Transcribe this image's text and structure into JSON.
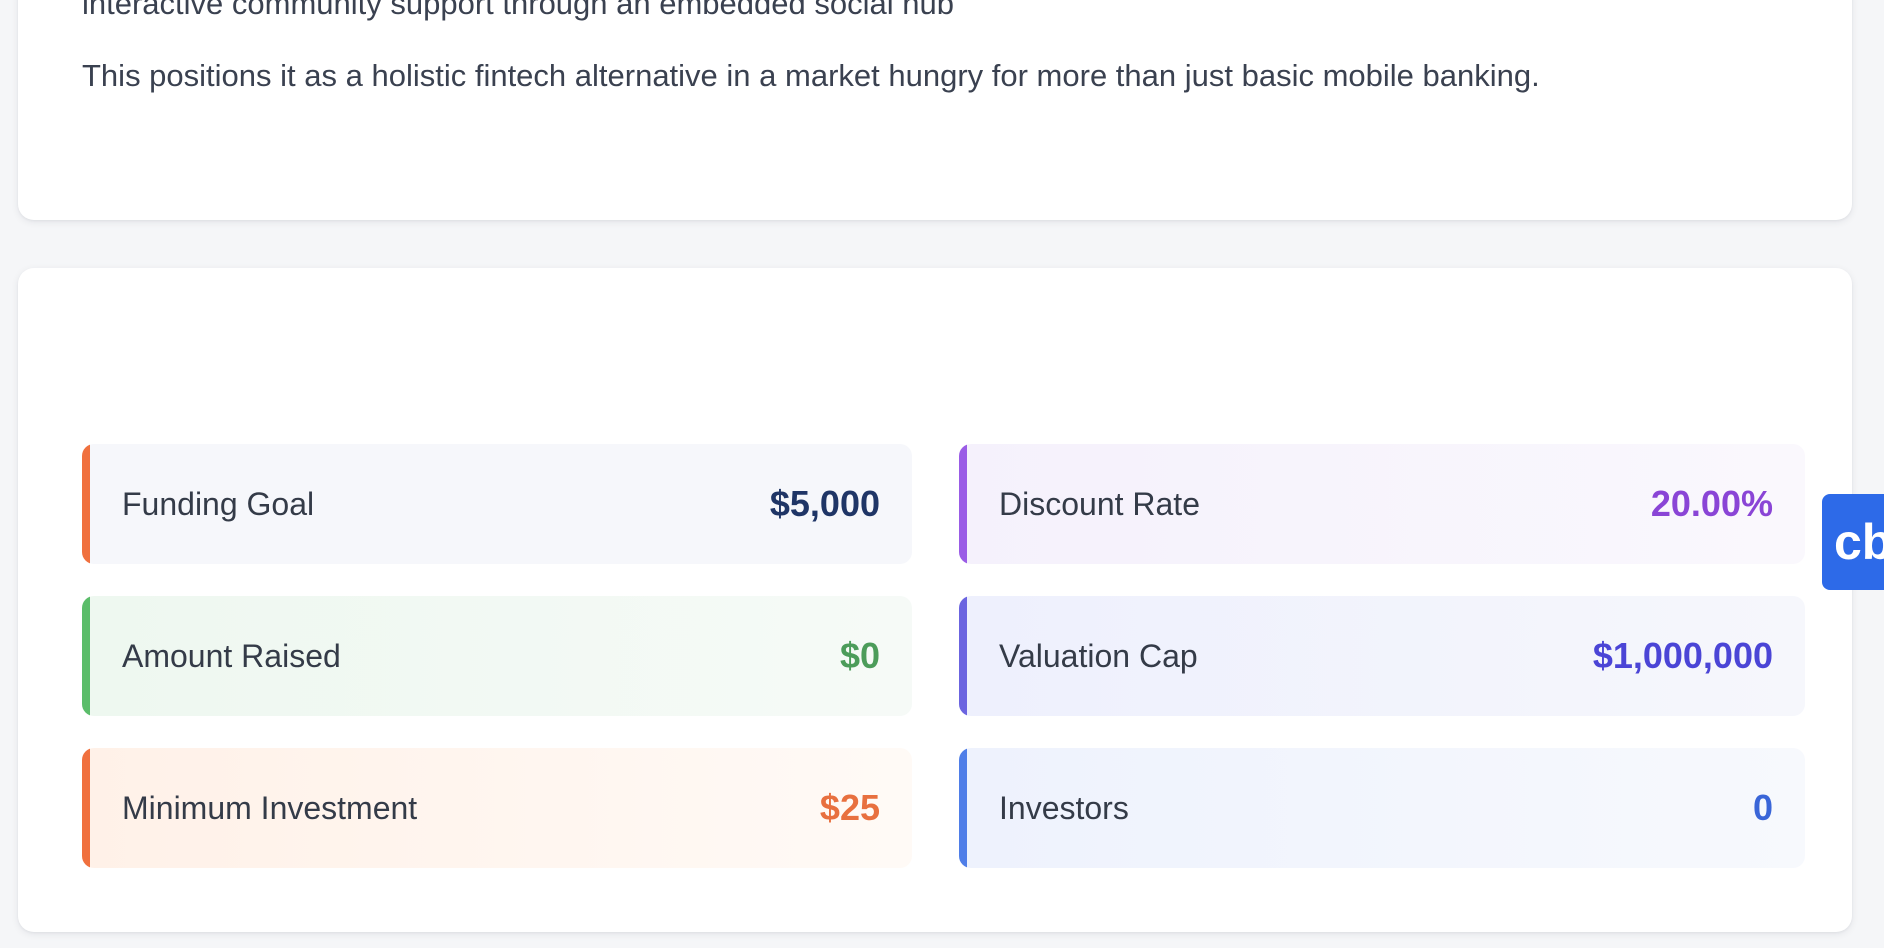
{
  "description_card": {
    "clipped_line": "interactive community support through an embedded social hub",
    "paragraph": "This positions it as a holistic fintech alternative in a market hungry for more than just basic mobile banking."
  },
  "metrics": {
    "funding_goal": {
      "label": "Funding Goal",
      "value": "$5,000",
      "accent": "#f0703e"
    },
    "amount_raised": {
      "label": "Amount Raised",
      "value": "$0",
      "accent": "#5bbd6a"
    },
    "minimum_investment": {
      "label": "Minimum Investment",
      "value": "$25",
      "accent": "#f0703e"
    },
    "discount_rate": {
      "label": "Discount Rate",
      "value": "20.00%",
      "accent": "#9a5ce6"
    },
    "valuation_cap": {
      "label": "Valuation Cap",
      "value": "$1,000,000",
      "accent": "#6b64e0"
    },
    "investors": {
      "label": "Investors",
      "value": "0",
      "accent": "#4f7ee8"
    }
  },
  "floating_button": {
    "label": "cb",
    "color": "#2d6ae8"
  }
}
